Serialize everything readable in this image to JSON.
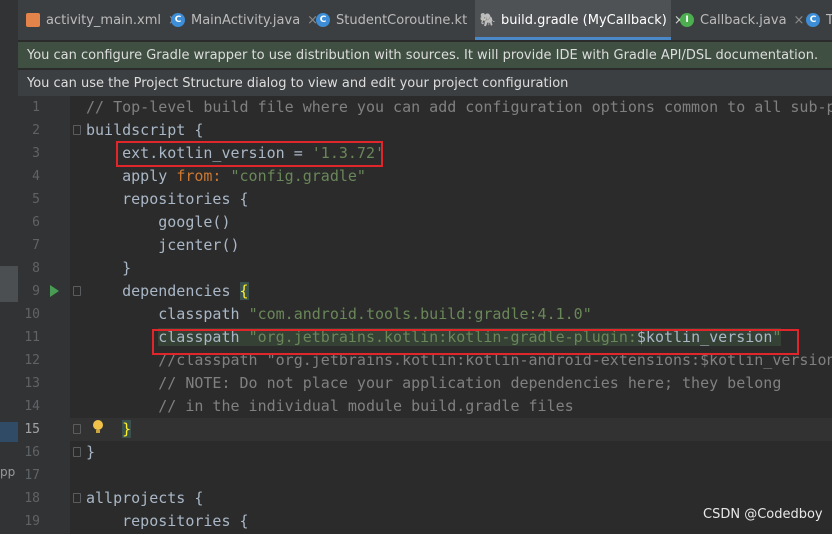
{
  "tabs": [
    {
      "label": "activity_main.xml",
      "icon": "xml-file-icon",
      "active": false
    },
    {
      "label": "MainActivity.java",
      "icon": "java-class-icon",
      "active": false
    },
    {
      "label": "StudentCoroutine.kt",
      "icon": "kotlin-class-icon",
      "active": false
    },
    {
      "label": "build.gradle (MyCallback)",
      "icon": "gradle-icon",
      "active": true
    },
    {
      "label": "Callback.java",
      "icon": "java-interface-icon",
      "active": false
    },
    {
      "label": "T",
      "icon": "java-class-icon",
      "active": false
    }
  ],
  "close_glyph": "×",
  "banners": [
    "You can configure Gradle wrapper to use distribution with sources. It will provide IDE with Gradle API/DSL documentation.",
    "You can use the Project Structure dialog to view and edit your project configuration"
  ],
  "left_panel_text": "pp",
  "current_line": 15,
  "code": [
    {
      "n": "1",
      "t": "// Top-level build file where you can add configuration options common to all sub-p"
    },
    {
      "n": "2",
      "t": "buildscript {"
    },
    {
      "n": "3",
      "t": "    ext.kotlin_version = '1.3.72'"
    },
    {
      "n": "4",
      "t": "    apply from: \"config.gradle\""
    },
    {
      "n": "5",
      "t": "    repositories {"
    },
    {
      "n": "6",
      "t": "        google()"
    },
    {
      "n": "7",
      "t": "        jcenter()"
    },
    {
      "n": "8",
      "t": "    }"
    },
    {
      "n": "9",
      "t": "    dependencies {"
    },
    {
      "n": "10",
      "t": "        classpath \"com.android.tools.build:gradle:4.1.0\""
    },
    {
      "n": "11",
      "t": "        classpath \"org.jetbrains.kotlin:kotlin-gradle-plugin:$kotlin_version\""
    },
    {
      "n": "12",
      "t": "        //classpath \"org.jetbrains.kotlin:kotlin-android-extensions:$kotlin_version"
    },
    {
      "n": "13",
      "t": "        // NOTE: Do not place your application dependencies here; they belong"
    },
    {
      "n": "14",
      "t": "        // in the individual module build.gradle files"
    },
    {
      "n": "15",
      "t": "    }"
    },
    {
      "n": "16",
      "t": "}"
    },
    {
      "n": "17",
      "t": ""
    },
    {
      "n": "18",
      "t": "allprojects {"
    },
    {
      "n": "19",
      "t": "    repositories {"
    }
  ],
  "watermark": "CSDN @Codedboy",
  "colors": {
    "keyword": "#cc7832",
    "string": "#6a8759",
    "comment": "#808080",
    "text": "#a9b7c6",
    "annotation_box": "#e0262b"
  }
}
